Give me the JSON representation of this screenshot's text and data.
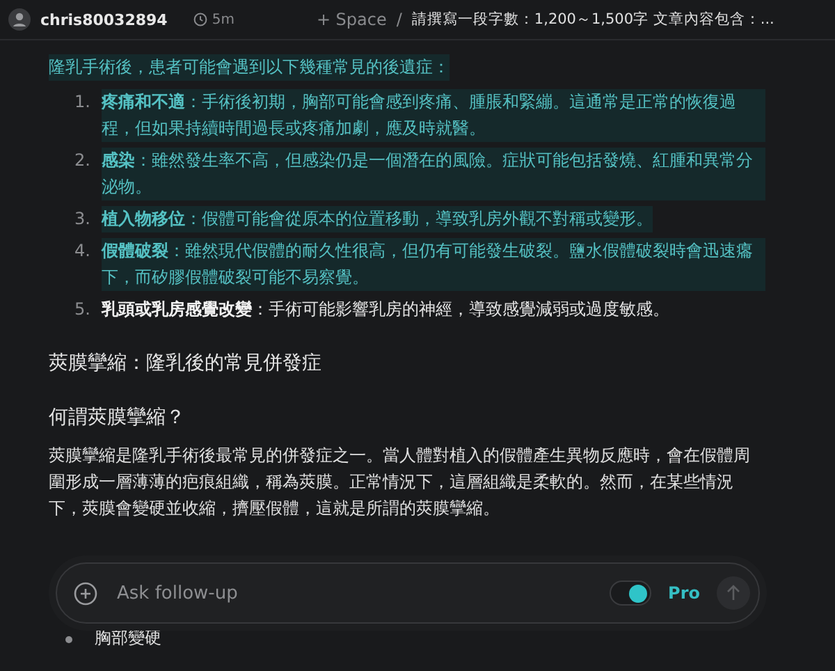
{
  "header": {
    "user": "chris80032894",
    "time": "5m",
    "space": "+ Space",
    "separator": "/",
    "title": "請撰寫一段字數：1,200～1,500字 文章內容包含：..."
  },
  "intro": {
    "text": "隆乳手術後，患者可能會遇到以下幾種常見的後遺症：",
    "highlighted": true
  },
  "list": [
    {
      "number": "1.",
      "text": "**疼痛和不適**：手術後初期，胸部可能會感到疼痛、腫脹和緊繃。這通常是正常的恢復過程，但如果持續時間過長或疼痛加劇，應及時就醫。",
      "highlighted": true
    },
    {
      "number": "2.",
      "text": "**感染**：雖然發生率不高，但感染仍是一個潛在的風險。症狀可能包括發燒、紅腫和異常分泌物。",
      "highlighted": true
    },
    {
      "number": "3.",
      "text": "**植入物移位**：假體可能會從原本的位置移動，導致乳房外觀不對稱或變形。",
      "highlighted": true
    },
    {
      "number": "4.",
      "text": "**假體破裂**：雖然現代假體的耐久性很高，但仍有可能發生破裂。鹽水假體破裂時會迅速癟下，而矽膠假體破裂可能不易察覺。",
      "highlighted": true
    },
    {
      "number": "5.",
      "text": "**乳頭或乳房感覺改變**：手術可能影響乳房的神經，導致感覺減弱或過度敏感。",
      "highlighted": false
    }
  ],
  "section_title": "莢膜攣縮：隆乳後的常見併發症",
  "subheading": "何謂莢膜攣縮？",
  "paragraph": "莢膜攣縮是隆乳手術後最常見的併發症之一。當人體對植入的假體產生異物反應時，會在假體周圍形成一層薄薄的疤痕組織，稱為莢膜。正常情況下，這層組織是柔軟的。然而，在某些情況下，莢膜會變硬並收縮，擠壓假體，這就是所謂的莢膜攣縮。",
  "bullets": [
    "胸部變硬"
  ],
  "composer": {
    "placeholder": "Ask follow-up",
    "pro_label": "Pro",
    "pro_on": true
  }
}
